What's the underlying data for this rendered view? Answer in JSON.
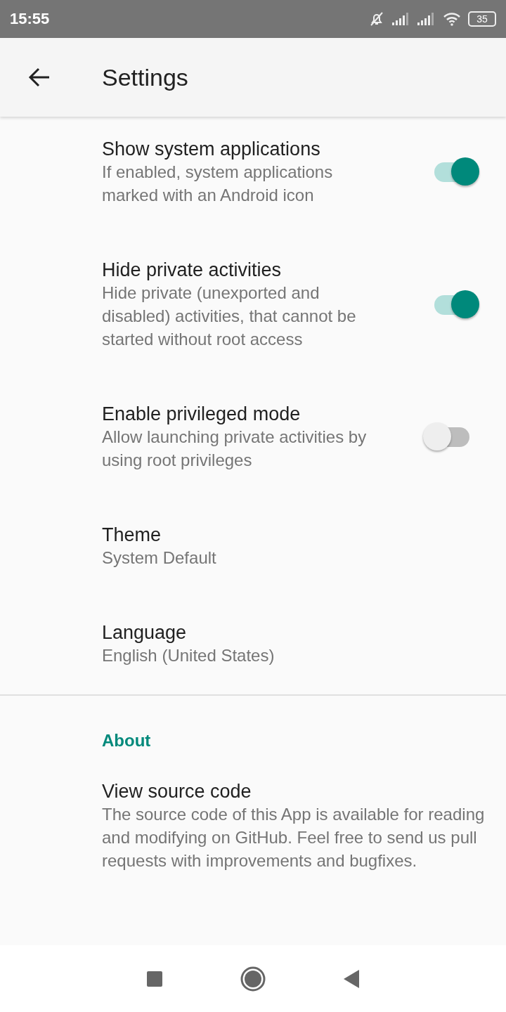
{
  "status_bar": {
    "time": "15:55",
    "battery": "35"
  },
  "app_bar": {
    "title": "Settings"
  },
  "preferences": [
    {
      "kind": "switch",
      "title": "Show system applications",
      "summary": "If enabled, system applications marked with an Android icon",
      "on": true
    },
    {
      "kind": "switch",
      "title": "Hide private activities",
      "summary": "Hide private (unexported and disabled) activities, that cannot be started without root access",
      "on": true
    },
    {
      "kind": "switch",
      "title": "Enable privileged mode",
      "summary": "Allow launching private activities by using root privileges",
      "on": false
    },
    {
      "kind": "plain",
      "title": "Theme",
      "summary": "System Default"
    },
    {
      "kind": "plain",
      "title": "Language",
      "summary": "English (United States)"
    }
  ],
  "about_section": {
    "header": "About",
    "items": [
      {
        "title": "View source code",
        "summary": "The source code of this App is available for reading and modifying on GitHub. Feel free to send us pull requests with improvements and bugfixes."
      }
    ]
  }
}
